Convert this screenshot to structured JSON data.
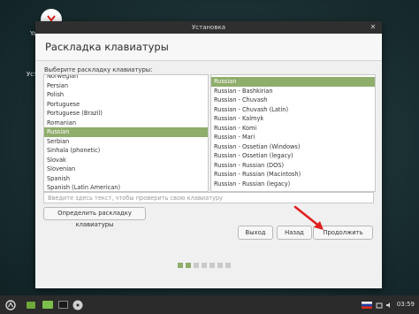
{
  "window": {
    "title": "Установка",
    "heading": "Раскладка клавиатуры",
    "prompt": "Выберите раскладку клавиатуры:"
  },
  "left_list": {
    "items": [
      "Norwegian",
      "Persian",
      "Polish",
      "Portuguese",
      "Portuguese (Brazil)",
      "Romanian",
      "Russian",
      "Serbian",
      "Sinhala (phonetic)",
      "Slovak",
      "Slovenian",
      "Spanish",
      "Spanish (Latin American)"
    ],
    "selected": "Russian"
  },
  "right_list": {
    "items": [
      "Russian",
      "Russian - Bashkirian",
      "Russian - Chuvash",
      "Russian - Chuvash (Latin)",
      "Russian - Kalmyk",
      "Russian - Komi",
      "Russian - Mari",
      "Russian - Ossetian (Windows)",
      "Russian - Ossetian (legacy)",
      "Russian - Russian (DOS)",
      "Russian - Russian (Macintosh)",
      "Russian - Russian (legacy)"
    ],
    "selected": "Russian"
  },
  "test_input": {
    "placeholder": "Введите здесь текст, чтобы проверить свою клавиатуру"
  },
  "buttons": {
    "detect": "Определить раскладку клавиатуры",
    "quit": "Выход",
    "back": "Назад",
    "next": "Продолжить"
  },
  "progress": {
    "total_steps": 7,
    "current_step": 2
  },
  "desktop": {
    "icon_label_1": "Ya",
    "icon_label_2": "Уст"
  },
  "taskbar": {
    "clock": "03:59"
  },
  "colors": {
    "accent": "#8fad6b",
    "arrow": "#e02020",
    "titlebar": "#2f2f2f"
  }
}
